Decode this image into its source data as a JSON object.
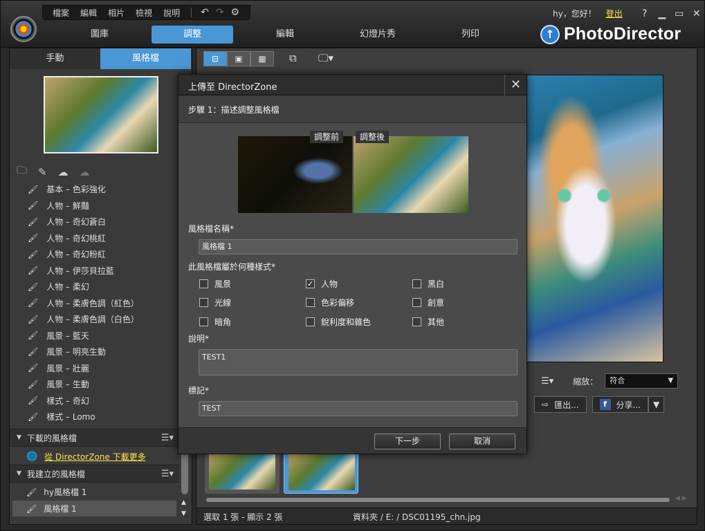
{
  "app": {
    "name": "PhotoDirector"
  },
  "menu": {
    "items": [
      "檔案",
      "編輯",
      "相片",
      "檢視",
      "說明"
    ]
  },
  "header": {
    "greeting": "hy，您好！",
    "logout": "登出",
    "help": "?",
    "minimize": "▁",
    "maximize": "▭",
    "close": "✕"
  },
  "main_tabs": [
    "圖庫",
    "調整",
    "編輯",
    "幻燈片秀",
    "列印"
  ],
  "active_main_tab": "調整",
  "left": {
    "subtabs": [
      "手動",
      "風格檔"
    ],
    "presets": [
      "基本 – 色彩強化",
      "人物 – 鮮豔",
      "人物 – 奇幻蒼白",
      "人物 – 奇幻桃紅",
      "人物 – 奇幻粉紅",
      "人物 – 伊莎貝拉藍",
      "人物 – 柔幻",
      "人物 – 柔膚色調（紅色）",
      "人物 – 柔膚色調（白色）",
      "風景 – 藍天",
      "風景 – 明亮生動",
      "風景 – 壯麗",
      "風景 – 生動",
      "樣式 – 奇幻",
      "樣式 – Lomo"
    ],
    "downloaded_header": "下載的風格檔",
    "dz_link": "從 DirectorZone 下載更多",
    "my_header": "我建立的風格檔",
    "my_presets": [
      "hy風格檔 1",
      "風格檔 1"
    ]
  },
  "view": {
    "zoom_label": "縮放：",
    "zoom_value": "符合",
    "export_label": "匯出...",
    "share_label": "分享..."
  },
  "status": {
    "selection": "選取 1 張 - 顯示 2 張",
    "folder": "資料夾 / E: / DSC01195_chn.jpg"
  },
  "dialog": {
    "title": "上傳至 DirectorZone",
    "step": "步驟 1：描述調整風格檔",
    "before_label": "調整前",
    "after_label": "調整後",
    "name_label": "風格檔名稱*",
    "name_value": "風格檔 1",
    "style_label": "此風格檔屬於何種樣式*",
    "styles": [
      {
        "label": "風景",
        "checked": false
      },
      {
        "label": "人物",
        "checked": true
      },
      {
        "label": "黑白",
        "checked": false
      },
      {
        "label": "光線",
        "checked": false
      },
      {
        "label": "色彩偏移",
        "checked": false
      },
      {
        "label": "創意",
        "checked": false
      },
      {
        "label": "暗角",
        "checked": false
      },
      {
        "label": "銳利度和雜色",
        "checked": false
      },
      {
        "label": "其他",
        "checked": false
      }
    ],
    "desc_label": "說明*",
    "desc_value": "TEST1",
    "tag_label": "標記*",
    "tag_value": "TEST",
    "next_button": "下一步",
    "cancel_button": "取消"
  },
  "colors": {
    "accent": "#4a97d6",
    "link": "#ffe14a",
    "panel": "#3a3a3a"
  }
}
